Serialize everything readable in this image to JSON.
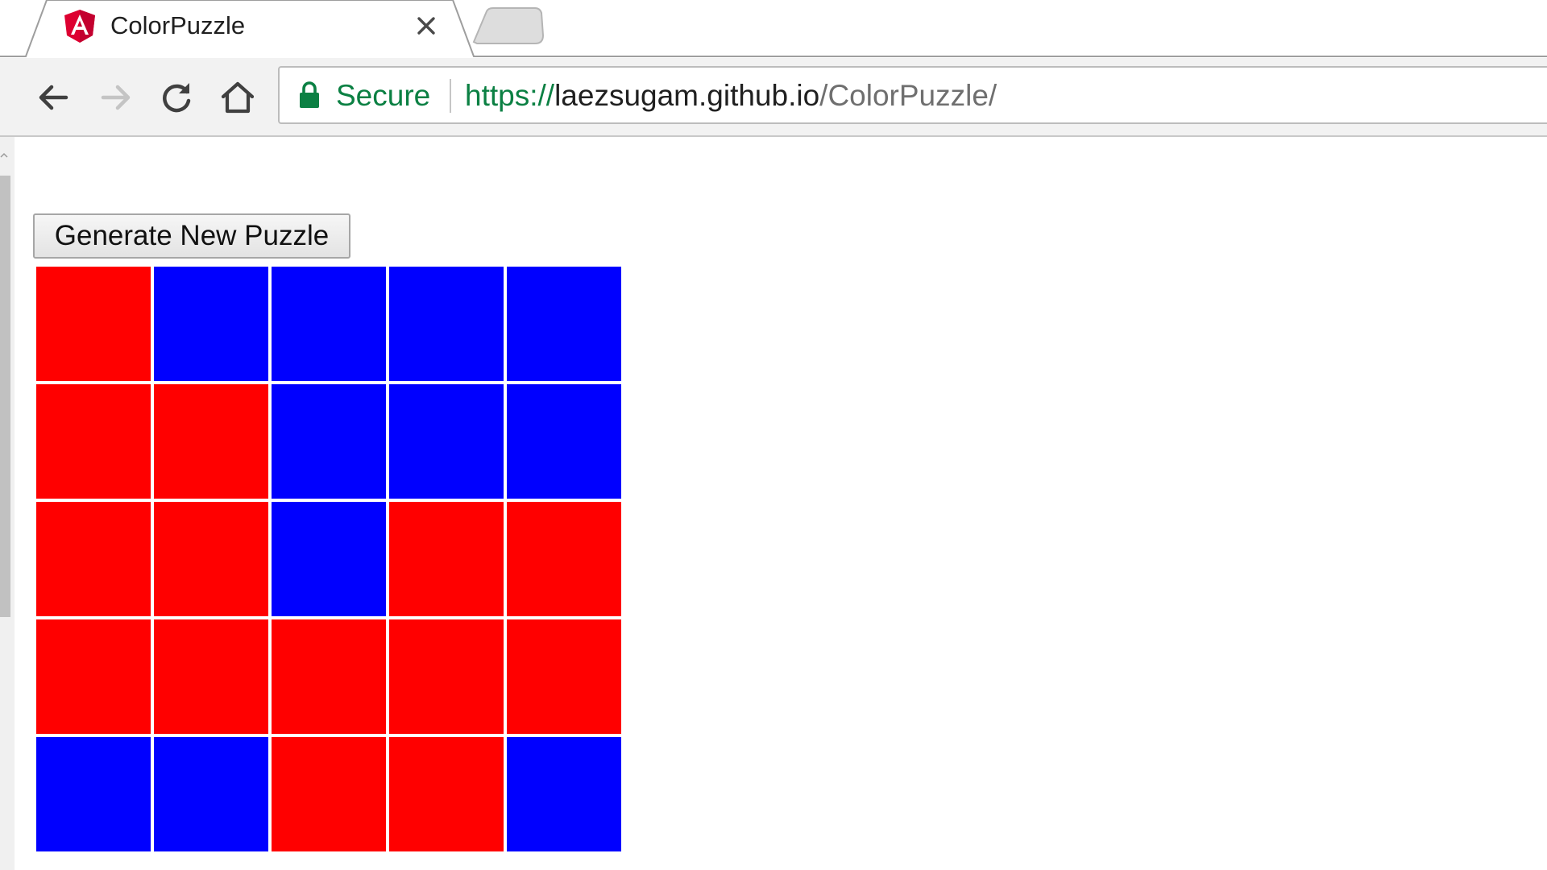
{
  "browser": {
    "tab": {
      "title": "ColorPuzzle",
      "favicon_icon": "angular-logo-icon",
      "close_icon": "close-icon"
    },
    "toolbar": {
      "back_icon": "back-arrow-icon",
      "forward_icon": "forward-arrow-icon",
      "reload_icon": "reload-icon",
      "home_icon": "home-icon"
    },
    "omnibox": {
      "security_icon": "lock-icon",
      "security_label": "Secure",
      "url_scheme": "https://",
      "url_host": "laezsugam.github.io",
      "url_path": "/ColorPuzzle/"
    }
  },
  "page": {
    "generate_button_label": "Generate New Puzzle",
    "colors": {
      "red": "#ff0000",
      "blue": "#0000ff"
    },
    "grid": [
      [
        "red",
        "blue",
        "blue",
        "blue",
        "blue"
      ],
      [
        "red",
        "red",
        "blue",
        "blue",
        "blue"
      ],
      [
        "red",
        "red",
        "blue",
        "red",
        "red"
      ],
      [
        "red",
        "red",
        "red",
        "red",
        "red"
      ],
      [
        "blue",
        "blue",
        "red",
        "red",
        "blue"
      ]
    ]
  }
}
